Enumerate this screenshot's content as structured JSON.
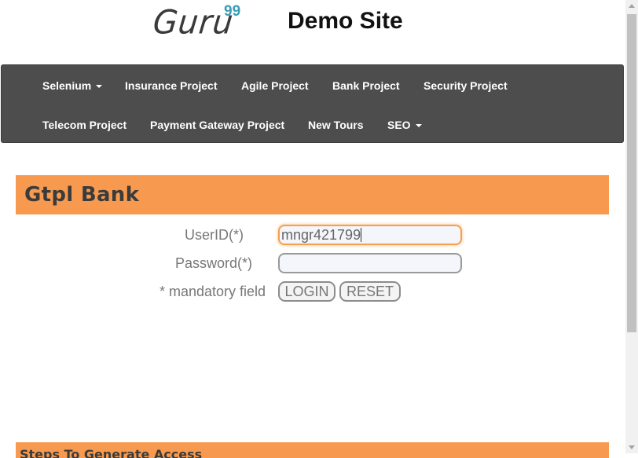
{
  "header": {
    "logo_text": "Guru",
    "logo_sup": "99",
    "site_title": "Demo Site"
  },
  "nav": {
    "row1": [
      "Selenium",
      "Insurance Project",
      "Agile Project",
      "Bank Project",
      "Security Project"
    ],
    "row2": [
      "Telecom Project",
      "Payment Gateway Project",
      "New Tours",
      "SEO"
    ],
    "dropdown_items": [
      "Selenium",
      "SEO"
    ]
  },
  "bank": {
    "title": "Gtpl Bank"
  },
  "login": {
    "userid_label": "UserID(*)",
    "userid_value": "mngr421799",
    "password_label": "Password(*)",
    "password_value": "",
    "mandatory_note": "* mandatory field",
    "login_button": "LOGIN",
    "reset_button": "RESET"
  },
  "steps": {
    "title": "Steps To Generate Access"
  },
  "colors": {
    "nav_bg": "#4d4d4d",
    "accent_orange": "#f79a4f",
    "logo_sup": "#3a9db5"
  }
}
